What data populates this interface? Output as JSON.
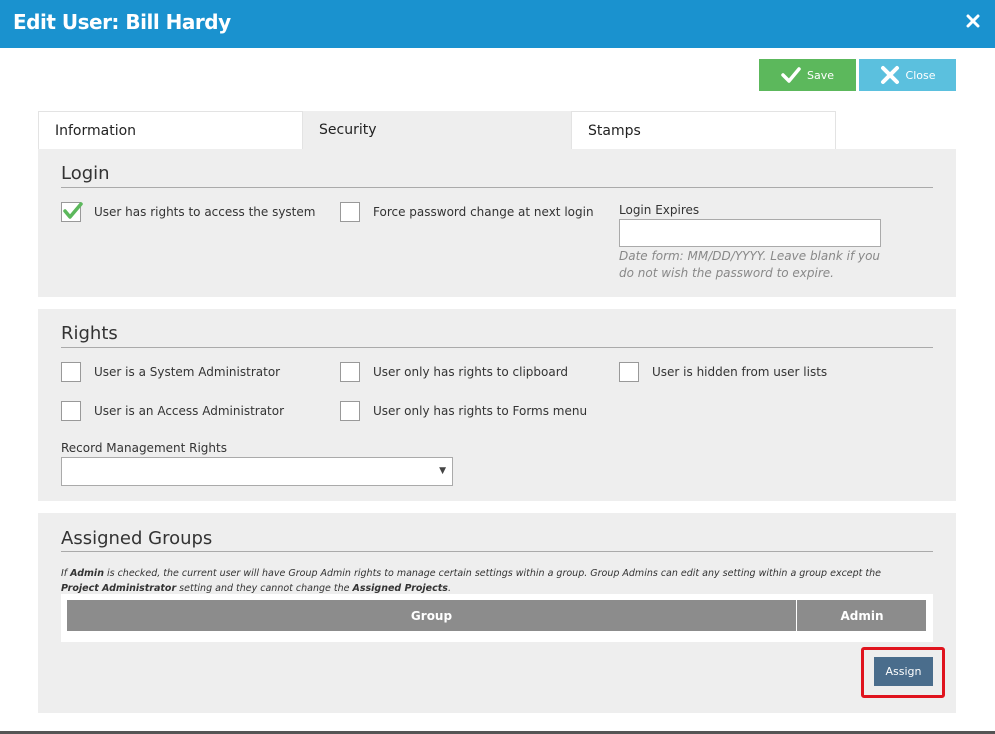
{
  "dialog": {
    "title": "Edit User: Bill Hardy",
    "close_icon": "close-x-icon"
  },
  "toolbar": {
    "save_label": "Save",
    "close_label": "Close"
  },
  "tabs": [
    {
      "label": "Information",
      "active": false
    },
    {
      "label": "Security",
      "active": true
    },
    {
      "label": "Stamps",
      "active": false
    }
  ],
  "login": {
    "title": "Login",
    "access_rights_label": "User has rights to access the system",
    "access_rights_checked": true,
    "force_password_label": "Force password change at next login",
    "force_password_checked": false,
    "login_expires_label": "Login Expires",
    "login_expires_value": "",
    "login_expires_hint": "Date form: MM/DD/YYYY. Leave blank if you do not wish the password to expire."
  },
  "rights": {
    "title": "Rights",
    "system_admin_label": "User is a System Administrator",
    "access_admin_label": "User is an Access Administrator",
    "clipboard_label": "User only has rights to clipboard",
    "forms_menu_label": "User only has rights to Forms menu",
    "hidden_label": "User is hidden from user lists",
    "record_mgmt_label": "Record Management Rights",
    "record_mgmt_value": ""
  },
  "groups": {
    "title": "Assigned Groups",
    "note_parts": {
      "p1": "If ",
      "b1": "Admin",
      "p2": " is checked, the current user will have Group Admin rights to manage certain settings within a group. Group Admins can edit any setting within a group except the ",
      "b2": "Project Administrator",
      "p3": " setting and they cannot change the ",
      "b3": "Assigned Projects",
      "p4": "."
    },
    "columns": [
      "Group",
      "Admin"
    ],
    "assign_label": "Assign"
  },
  "colors": {
    "header": "#1a92cf",
    "save": "#5cb85c",
    "close": "#5bc0de",
    "assign": "#4a6d8c",
    "highlight": "#e0141e"
  }
}
